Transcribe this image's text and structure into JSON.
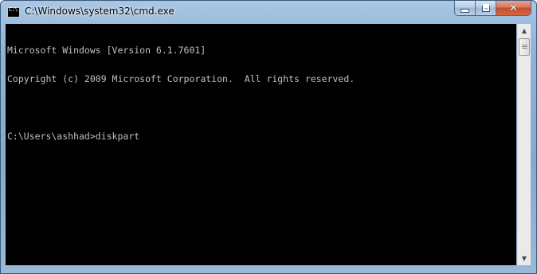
{
  "window": {
    "title": "C:\\Windows\\system32\\cmd.exe",
    "app_icon_text": "C:\\",
    "controls": {
      "minimize_icon": "minimize-icon",
      "maximize_icon": "maximize-icon",
      "close_icon": "close-icon",
      "close_glyph": "✕"
    }
  },
  "console": {
    "lines": [
      "Microsoft Windows [Version 6.1.7601]",
      "Copyright (c) 2009 Microsoft Corporation.  All rights reserved.",
      "",
      "C:\\Users\\ashhad>diskpart"
    ],
    "background_color": "#000000",
    "text_color": "#c0c0c0"
  },
  "scrollbar": {
    "up_glyph": "▲",
    "down_glyph": "▼"
  }
}
